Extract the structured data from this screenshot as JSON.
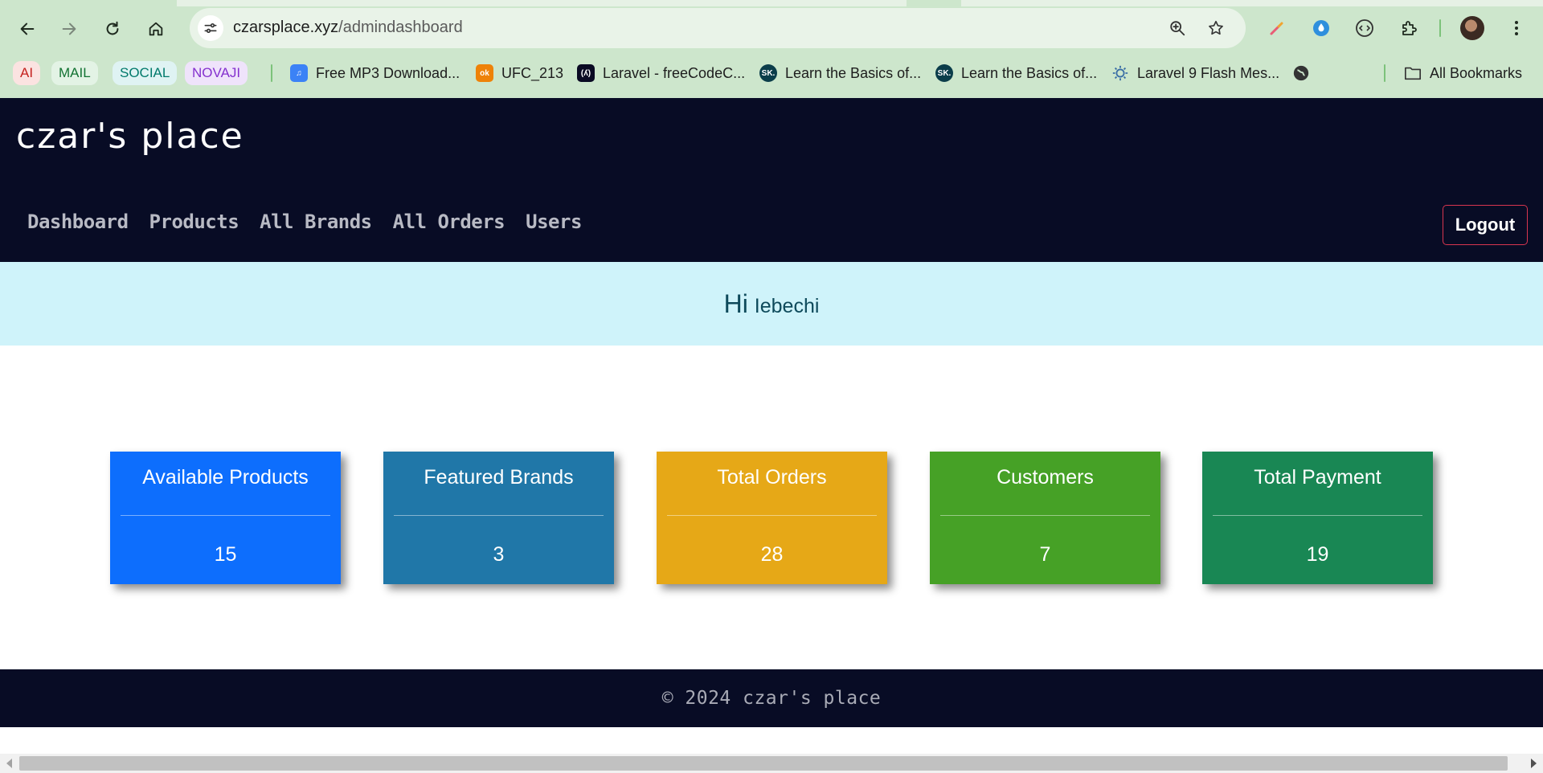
{
  "browser": {
    "url_domain": "czarsplace.xyz",
    "url_path": "/admindashboard",
    "chips": [
      {
        "label": "AI",
        "bg": "#fbe3e1",
        "color": "#c5221f"
      },
      {
        "label": "MAIL",
        "bg": "#e3f3e5",
        "color": "#137333"
      },
      {
        "label": "SOCIAL",
        "bg": "#dff3f3",
        "color": "#00796b"
      },
      {
        "label": "NOVAJI",
        "bg": "#efe3fb",
        "color": "#8430ce"
      }
    ],
    "bookmarks": [
      {
        "label": "Free MP3 Download...",
        "icon": "music-icon",
        "icon_color": "#3b82f6"
      },
      {
        "label": "UFC_213",
        "icon": "ok-icon",
        "icon_color": "#ee8208"
      },
      {
        "label": "Laravel - freeCodeC...",
        "icon": "freecodecamp-icon",
        "icon_color": "#0a0a23"
      },
      {
        "label": "Learn the Basics of...",
        "icon": "sk-icon",
        "icon_color": "#0b3d4a"
      },
      {
        "label": "Learn the Basics of...",
        "icon": "sk-icon",
        "icon_color": "#0b3d4a"
      },
      {
        "label": "Laravel 9 Flash Mes...",
        "icon": "gear-bulb-icon",
        "icon_color": "#3a6ea5"
      }
    ],
    "all_bookmarks_label": "All Bookmarks"
  },
  "site": {
    "brand": "czar's place",
    "nav": [
      "Dashboard",
      "Products",
      "All Brands",
      "All Orders",
      "Users"
    ],
    "logout_label": "Logout",
    "greeting_hi": "Hi",
    "greeting_name": "Iebechi",
    "cards": [
      {
        "title": "Available Products",
        "value": "15",
        "color": "#0d6efd"
      },
      {
        "title": "Featured Brands",
        "value": "3",
        "color": "#2077a8"
      },
      {
        "title": "Total Orders",
        "value": "28",
        "color": "#e6a817"
      },
      {
        "title": "Customers",
        "value": "7",
        "color": "#46a126"
      },
      {
        "title": "Total Payment",
        "value": "19",
        "color": "#198754"
      }
    ],
    "footer_text": "© 2024 czar's place"
  }
}
